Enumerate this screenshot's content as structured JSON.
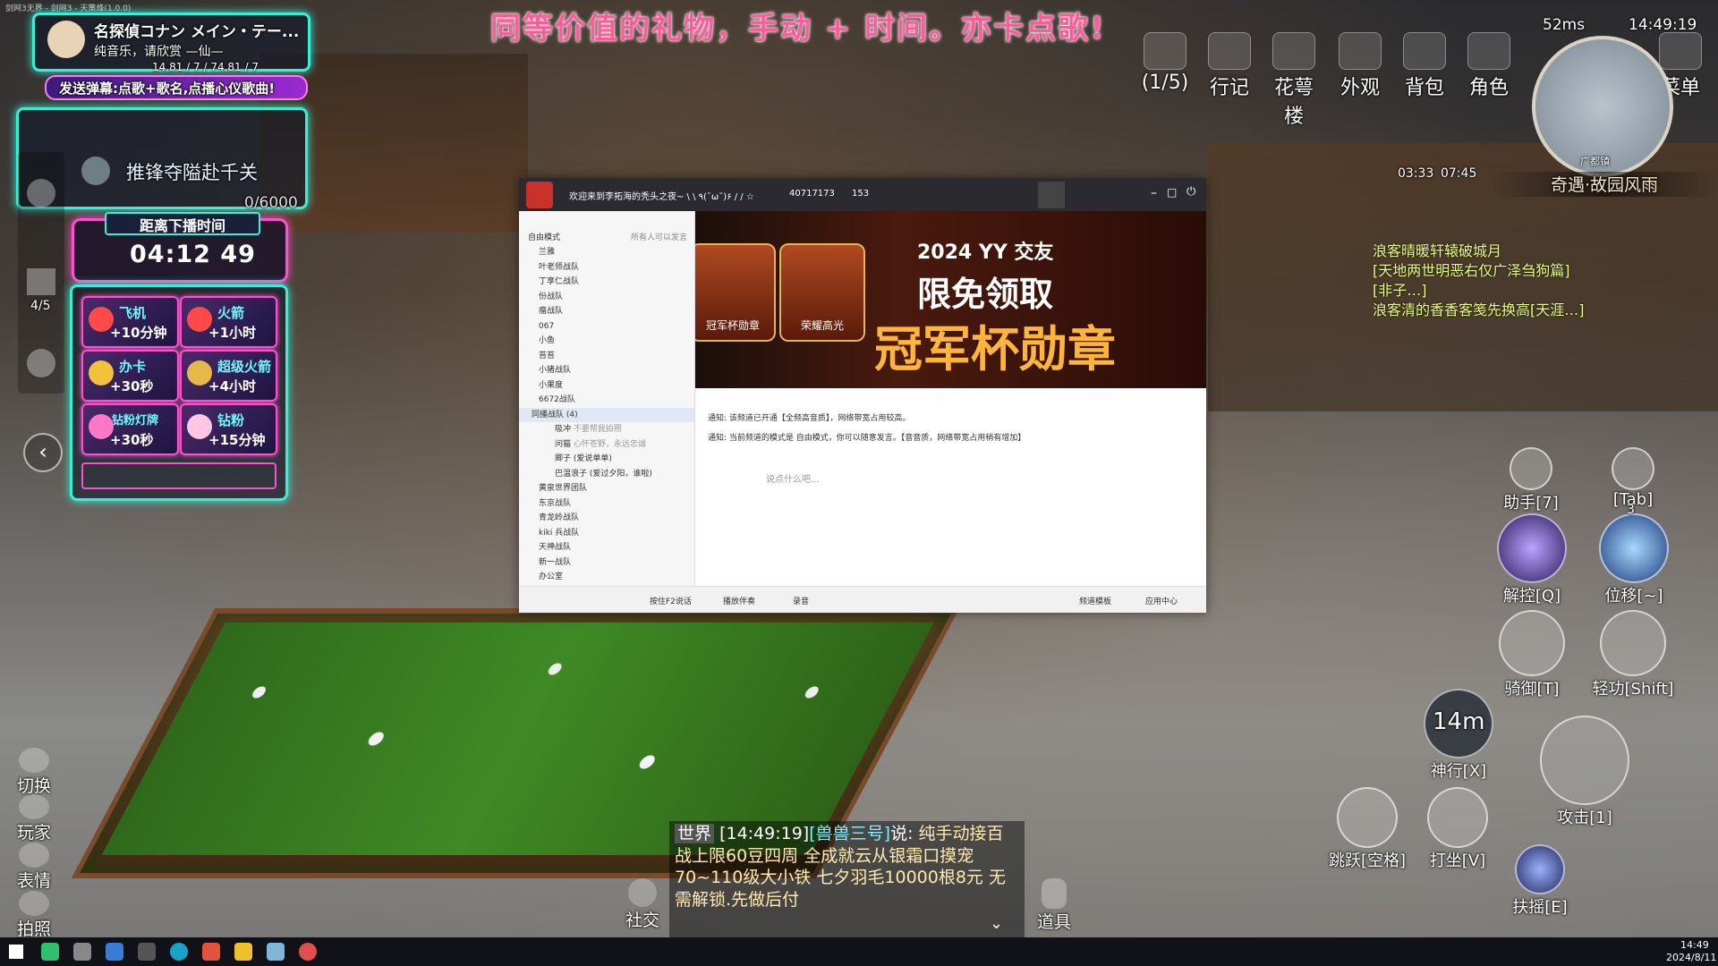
{
  "window_title": "剑网3无界 - 剑网3 - 天策烽(1.0.0)",
  "promo_text": "同等价值的礼物，手动 + 时间。亦卡点歌!",
  "stream_panel": {
    "streamer_name": "名探偵コナン メイン・テー...",
    "streamer_sub": "纯音乐，请欣赏 —仙—",
    "marquee": "14.81 / 7 / 74.81 / 7",
    "danmu_tip": "发送弹幕:点歌+歌名,点播心仪歌曲!",
    "quest_label": "推锋夺隘赴千关",
    "quest_progress": "0/6000",
    "countdown_title": "距离下播时间",
    "countdown": "04:12 49",
    "flag_count": "4/5",
    "gifts": [
      {
        "name": "飞机",
        "time": "+10分钟"
      },
      {
        "name": "火箭",
        "time": "+1小时"
      },
      {
        "name": "办卡",
        "time": "+30秒"
      },
      {
        "name": "超级火箭",
        "time": "+4小时"
      },
      {
        "name": "钻粉灯牌",
        "time": "+30秒"
      },
      {
        "name": "钻粉",
        "time": "+15分钟"
      }
    ]
  },
  "yy": {
    "title": "欢迎来到李拓海的秃头之夜~ \\ \\ ٩(˘ω˘)۶ / / ☆",
    "room_id": "40717173",
    "user_count": "153",
    "mode": "自由模式",
    "mode_hint": "所有人可以发言",
    "channels": [
      "兰雅",
      "叶老师战队",
      "丁享仁战队",
      "份战队",
      "瘤战队",
      "067",
      "小鱼",
      "苔苔",
      "小猪战队",
      "小果度",
      "6672战队"
    ],
    "active_channel": "同播战队 (4)",
    "members": [
      {
        "name": "吸冲",
        "tag": "不要帮我拍照"
      },
      {
        "name": "问猫",
        "tag": "心怀苍野，永远忠诚"
      },
      {
        "name": "卿子 (爱说单单)",
        "tag": ""
      },
      {
        "name": "巴温浪子 (爱过夕阳，谁啦)",
        "tag": ""
      }
    ],
    "more_channels": [
      "黄泉世界团队",
      "东京战队",
      "青龙岭战队",
      "kiki 兵战队",
      "天神战队",
      "新一战队",
      "办公室"
    ],
    "banner_title": "2024 YY 交友",
    "banner_line1": "限免领取",
    "banner_line2": "冠军杯勋章",
    "medal1": "冠军杯勋章",
    "medal2": "荣耀高光",
    "notices": [
      "通知: 该频道已开通【全频高音质】，网络带宽占用较高。",
      "通知: 当前频道的模式是 自由模式，你可以随意发言。【音音质，网络带宽占用稍有增加】"
    ],
    "input_placeholder": "说点什么吧...",
    "bottom": {
      "ptt": "按住F2说话",
      "music": "播放伴奏",
      "record": "录音",
      "template": "频道模板",
      "app_center": "应用中心"
    }
  },
  "hud": {
    "ping": "52ms",
    "clock": "14:49:19",
    "top_icons": [
      {
        "label": "(1/5)"
      },
      {
        "label": "行记"
      },
      {
        "label": "花萼楼"
      },
      {
        "label": "外观"
      },
      {
        "label": "背包"
      },
      {
        "label": "角色"
      },
      {
        "label": "菜单"
      }
    ],
    "timer1": "03:33",
    "timer2": "07:45",
    "map_name": "广都镇",
    "zone_banner": "奇遇·故园风雨",
    "right_chat": [
      "浪客晴暖轩辕破城月",
      "[天地两世明恶右仅广泽刍狗篇]",
      "[非子…]",
      "浪客清的香香客笺先换高[天涯…]"
    ],
    "skills": [
      {
        "label": "助手[7]"
      },
      {
        "label": "[Tab]"
      },
      {
        "label": "解控[Q]"
      },
      {
        "label": "位移[~]"
      },
      {
        "label": "骑御[T]"
      },
      {
        "label": "轻功[Shift]"
      },
      {
        "label": "神行[X]",
        "value": "14m"
      },
      {
        "label": "攻击[1]"
      },
      {
        "label": "跳跃[空格]"
      },
      {
        "label": "打坐[V]"
      },
      {
        "label": "扶摇[E]"
      }
    ],
    "move_badge": "3",
    "left_buttons": [
      "切换",
      "玩家",
      "表情",
      "拍照"
    ],
    "social": "社交",
    "items": "道具"
  },
  "chat": {
    "channel": "世界",
    "time": "[14:49:19]",
    "speaker": "[兽兽三号]",
    "said": "说:",
    "message": "纯手动接百战上限60豆四周 全成就云从银霜口摸宠 70~110级大小铁 七夕羽毛10000根8元 无需解锁.先做后付"
  },
  "taskbar": {
    "time": "14:49",
    "date": "2024/8/11"
  }
}
